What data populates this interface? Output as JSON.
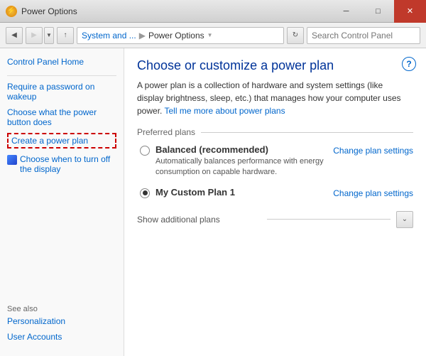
{
  "titlebar": {
    "title": "Power Options",
    "icon": "⚡",
    "min_btn": "─",
    "max_btn": "□",
    "close_btn": "✕"
  },
  "navbar": {
    "back_btn": "◀",
    "forward_btn": "▶",
    "dropdown_btn": "▼",
    "up_btn": "↑",
    "breadcrumb": {
      "system": "System and ...",
      "separator": "▶",
      "current": "Power Options",
      "dropdown_arrow": "▼"
    },
    "refresh_btn": "↻",
    "search_placeholder": "Search Control Panel",
    "search_icon": "🔍"
  },
  "sidebar": {
    "home_link": "Control Panel Home",
    "links": [
      {
        "id": "require-password",
        "label": "Require a password on wakeup",
        "icon": false
      },
      {
        "id": "power-button",
        "label": "Choose what the power button does",
        "icon": false
      },
      {
        "id": "create-plan",
        "label": "Create a power plan",
        "icon": false,
        "highlighted": true
      },
      {
        "id": "turn-off-display",
        "label": "Choose when to turn off the display",
        "icon": true
      }
    ],
    "see_also": "See also",
    "bottom_links": [
      {
        "id": "personalization",
        "label": "Personalization"
      },
      {
        "id": "user-accounts",
        "label": "User Accounts"
      }
    ]
  },
  "content": {
    "title": "Choose or customize a power plan",
    "description": "A power plan is a collection of hardware and system settings (like display brightness, sleep, etc.) that manages how your computer uses power.",
    "learn_more_text": "Tell me more about power plans",
    "preferred_plans_label": "Preferred plans",
    "plans": [
      {
        "id": "balanced",
        "name": "Balanced (recommended)",
        "description": "Automatically balances performance with energy consumption on capable hardware.",
        "selected": false,
        "change_link": "Change plan settings"
      },
      {
        "id": "custom",
        "name": "My Custom Plan 1",
        "description": "",
        "selected": true,
        "change_link": "Change plan settings"
      }
    ],
    "show_additional": "Show additional plans",
    "show_additional_btn": "⌄",
    "help_icon": "?"
  }
}
